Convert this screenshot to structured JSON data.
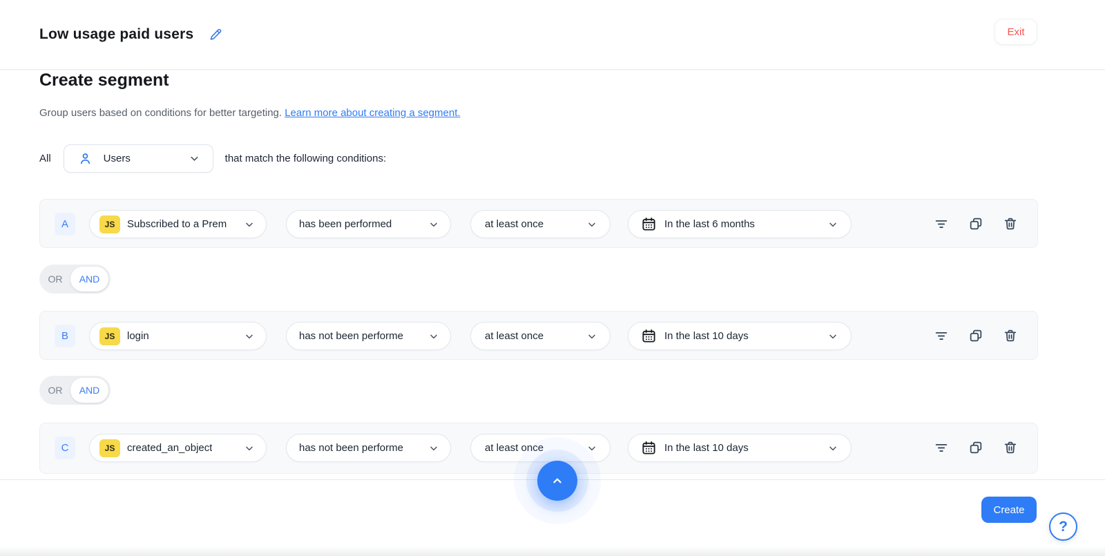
{
  "header": {
    "title": "Low usage paid users",
    "exit_label": "Exit"
  },
  "page": {
    "heading": "Create segment",
    "description": "Group users based on conditions for better targeting.",
    "learn_more_link": "Learn more about creating a segment.",
    "qualifier": {
      "prefix": "All",
      "audience": "Users",
      "suffix": "that match the following conditions:"
    }
  },
  "conditions": [
    {
      "label": "A",
      "event_badge": "JS",
      "event": "Subscribed to a Prem",
      "operator": "has been performed",
      "frequency": "at least once",
      "timeframe": "In the last 6 months"
    },
    {
      "label": "B",
      "event_badge": "JS",
      "event": "login",
      "operator": "has not been performe",
      "frequency": "at least once",
      "timeframe": "In the last 10 days"
    },
    {
      "label": "C",
      "event_badge": "JS",
      "event": "created_an_object",
      "operator": "has not been performe",
      "frequency": "at least once",
      "timeframe": "In the last 10 days"
    }
  ],
  "logic_toggle": {
    "or_label": "OR",
    "and_label": "AND",
    "selected": "AND"
  },
  "footer": {
    "create_label": "Create",
    "help_label": "?"
  },
  "icons": {
    "pencil": "edit-pencil",
    "user": "users-audience",
    "chevron_down": "expand-dropdown",
    "calendar": "date-range",
    "filter": "add-attribute-filter",
    "copy": "duplicate-condition",
    "trash": "delete-condition",
    "chevron_up": "scroll-to-top",
    "question": "help"
  },
  "colors": {
    "accent_blue": "#2e7cf6",
    "badge_blue_bg": "#ecf3fe",
    "badge_blue_text": "#3b7cf6",
    "js_yellow": "#f7d94a",
    "exit_red": "#f45454",
    "icon_slate": "#33475b",
    "row_bg": "#f8f9fb",
    "toggle_bg": "#edeff3",
    "text_dark": "#16181d",
    "text_gray": "#565e69"
  }
}
